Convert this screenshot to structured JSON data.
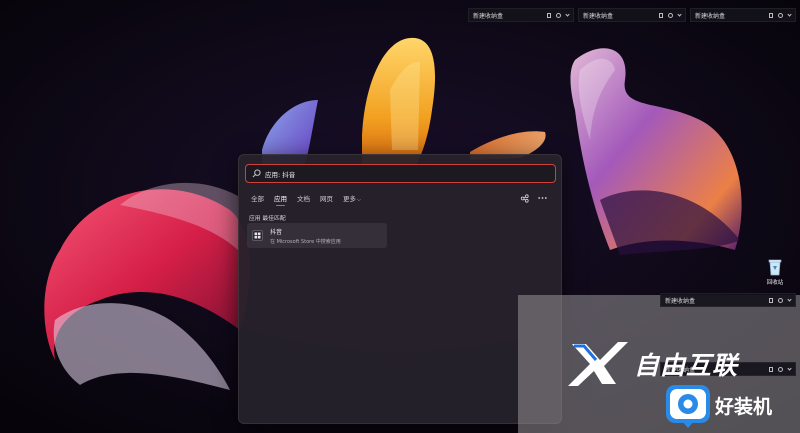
{
  "desktop": {
    "box_widgets_top": [
      {
        "title": "新建收纳盒"
      },
      {
        "title": "新建收纳盒"
      },
      {
        "title": "新建收纳盒"
      }
    ],
    "box_widgets_side": [
      {
        "title": "新建收纳盒"
      },
      {
        "title": "新建收纳盒"
      }
    ],
    "recycle_bin_label": "回收站"
  },
  "search": {
    "query": "应用: 抖音",
    "tabs": [
      {
        "label": "全部"
      },
      {
        "label": "应用"
      },
      {
        "label": "文档"
      },
      {
        "label": "网页"
      },
      {
        "label": "更多"
      }
    ],
    "active_tab": "应用",
    "more_chevron": "chevron-down-icon",
    "section_title": "应用 最佳匹配",
    "best_match": {
      "name": "抖音",
      "subtitle": "在 Microsoft Store 中搜索应用",
      "icon": "store-app-icon"
    }
  },
  "watermark": {
    "brand": "自由互联",
    "secondary": "好装机"
  },
  "colors": {
    "search_border": "#d0403a",
    "tab_underline": "#e05a4f",
    "panel_bg": "#26222a"
  }
}
